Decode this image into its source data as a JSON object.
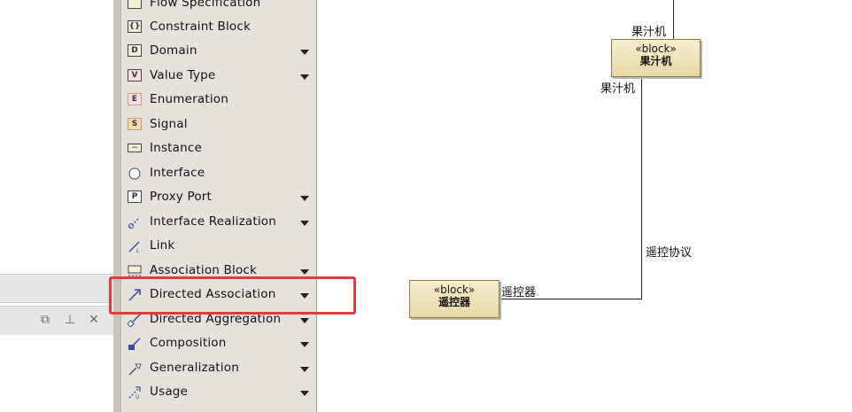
{
  "left_panel": {
    "buttons": [
      {
        "name": "restore-icon",
        "glyph": "⧉"
      },
      {
        "name": "pin-icon",
        "glyph": "⊥"
      },
      {
        "name": "close-icon",
        "glyph": "✕"
      }
    ]
  },
  "palette": {
    "items": [
      {
        "label": "Flow Specification",
        "icon": "flow-specification-icon",
        "arrow": false
      },
      {
        "label": "Constraint Block",
        "icon": "constraint-block-icon",
        "arrow": false
      },
      {
        "label": "Domain",
        "icon": "domain-icon",
        "arrow": true
      },
      {
        "label": "Value Type",
        "icon": "value-type-icon",
        "arrow": true
      },
      {
        "label": "Enumeration",
        "icon": "enumeration-icon",
        "arrow": false
      },
      {
        "label": "Signal",
        "icon": "signal-icon",
        "arrow": false
      },
      {
        "label": "Instance",
        "icon": "instance-icon",
        "arrow": false
      },
      {
        "label": "Interface",
        "icon": "interface-icon",
        "arrow": false
      },
      {
        "label": "Proxy Port",
        "icon": "proxy-port-icon",
        "arrow": true
      },
      {
        "label": "Interface Realization",
        "icon": "interface-realization-icon",
        "arrow": true
      },
      {
        "label": "Link",
        "icon": "link-icon",
        "arrow": false
      },
      {
        "label": "Association Block",
        "icon": "association-block-icon",
        "arrow": true
      },
      {
        "label": "Directed Association",
        "icon": "directed-association-icon",
        "arrow": true
      },
      {
        "label": "Directed Aggregation",
        "icon": "directed-aggregation-icon",
        "arrow": true
      },
      {
        "label": "Composition",
        "icon": "composition-icon",
        "arrow": true
      },
      {
        "label": "Generalization",
        "icon": "generalization-icon",
        "arrow": true
      },
      {
        "label": "Usage",
        "icon": "usage-icon",
        "arrow": true
      }
    ]
  },
  "diagram": {
    "juicer": {
      "stereotype": "«block»",
      "name": "果汁机"
    },
    "remote": {
      "stereotype": "«block»",
      "name": "遥控器"
    },
    "labels": {
      "juicer_top": "果汁机",
      "juicer_bottom": "果汁机",
      "association": "遥控协议",
      "remote_end": "遥控器"
    }
  },
  "colors": {
    "highlight": "#e23b3b",
    "block_fill": "#f0e4b8"
  }
}
